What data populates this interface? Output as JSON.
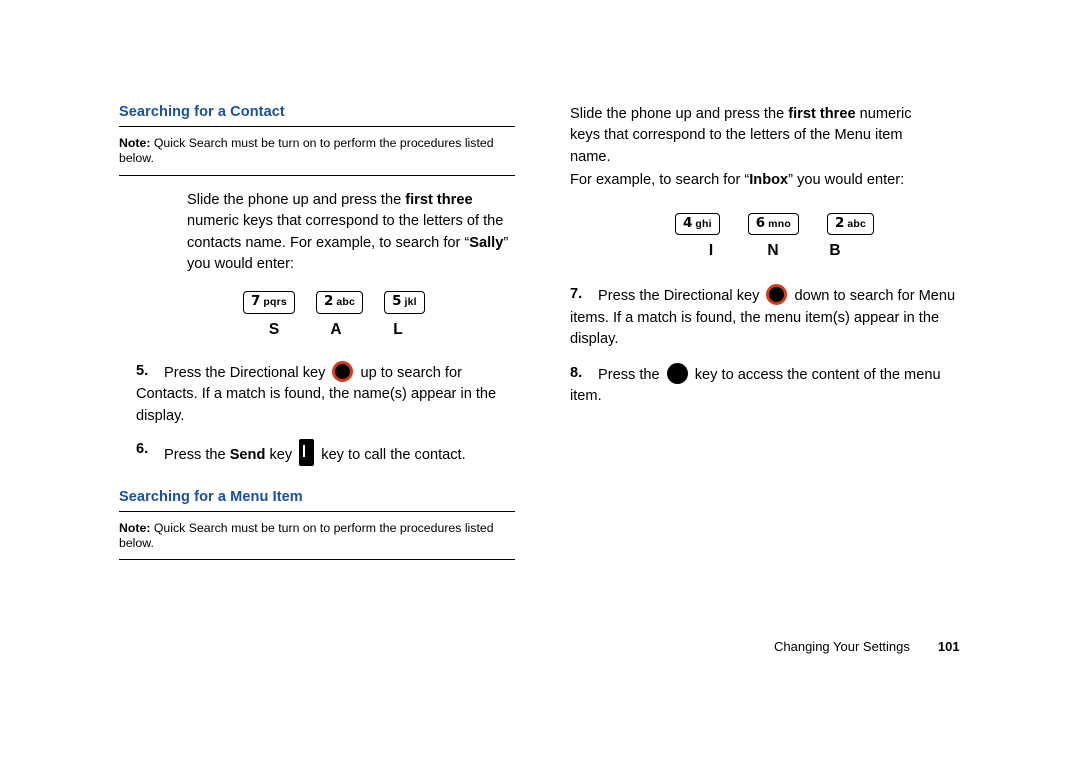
{
  "left_column": {
    "section_heading": "Searching for a Contact",
    "note_label": "Note:",
    "note_text": " Quick Search must be turn on to perform the procedures listed below.",
    "intro_paragraph": {
      "part1": "Slide the phone up and press the ",
      "bold1": "first three",
      "part2": " numeric keys that correspond to the letters of the contacts name. For example, to search for “",
      "bold2": "Sally",
      "part3": "” you would enter:"
    },
    "keys": [
      {
        "digit": "7",
        "letters": "pqrs"
      },
      {
        "digit": "2",
        "letters": "abc"
      },
      {
        "digit": "5",
        "letters": "jkl"
      }
    ],
    "key_letters": [
      "S",
      "A",
      "L"
    ],
    "steps": [
      {
        "number": "5.",
        "text_before": "Press the Directional key ",
        "icon": "directional-key-icon",
        "text_after": " up to search for Contacts. If a match is found, the name(s) appear in the display."
      },
      {
        "number": "6.",
        "text_before": "Press the ",
        "bold": "Send",
        "text_middle": " key ",
        "icon": "send-key-icon",
        "text_after": " key to call the contact."
      }
    ],
    "section_heading_2": "Searching for a Menu Item",
    "note_label_2": "Note:",
    "note_text_2": " Quick Search must be turn on to perform the procedures listed below."
  },
  "right_column": {
    "intro_paragraph": {
      "part1": "Slide the phone up and press the ",
      "bold1": "first three",
      "part2": " numeric keys that correspond to the letters of the Menu item name."
    },
    "example_line": {
      "part1": "For example, to search for “",
      "bold1": "Inbox",
      "part2": "” you would enter:"
    },
    "keys": [
      {
        "digit": "4",
        "letters": "ghi"
      },
      {
        "digit": "6",
        "letters": "mno"
      },
      {
        "digit": "2",
        "letters": "abc"
      }
    ],
    "key_letters": [
      "I",
      "N",
      "B"
    ],
    "steps": [
      {
        "number": "7.",
        "text_before": "Press the Directional key ",
        "icon": "directional-key-icon",
        "text_after": " down to search for Menu items. If a match is found, the menu item(s) appear in the display."
      },
      {
        "number": "8.",
        "text_before": "Press the ",
        "icon": "ok-key-icon",
        "text_after": " key to access the content of the menu item."
      }
    ]
  },
  "footer": {
    "chapter": "Changing Your Settings",
    "page_number": "101"
  },
  "colors": {
    "heading_blue": "#1b4fa0",
    "key_ring_red": "#d13b1f",
    "text_black": "#000000"
  }
}
